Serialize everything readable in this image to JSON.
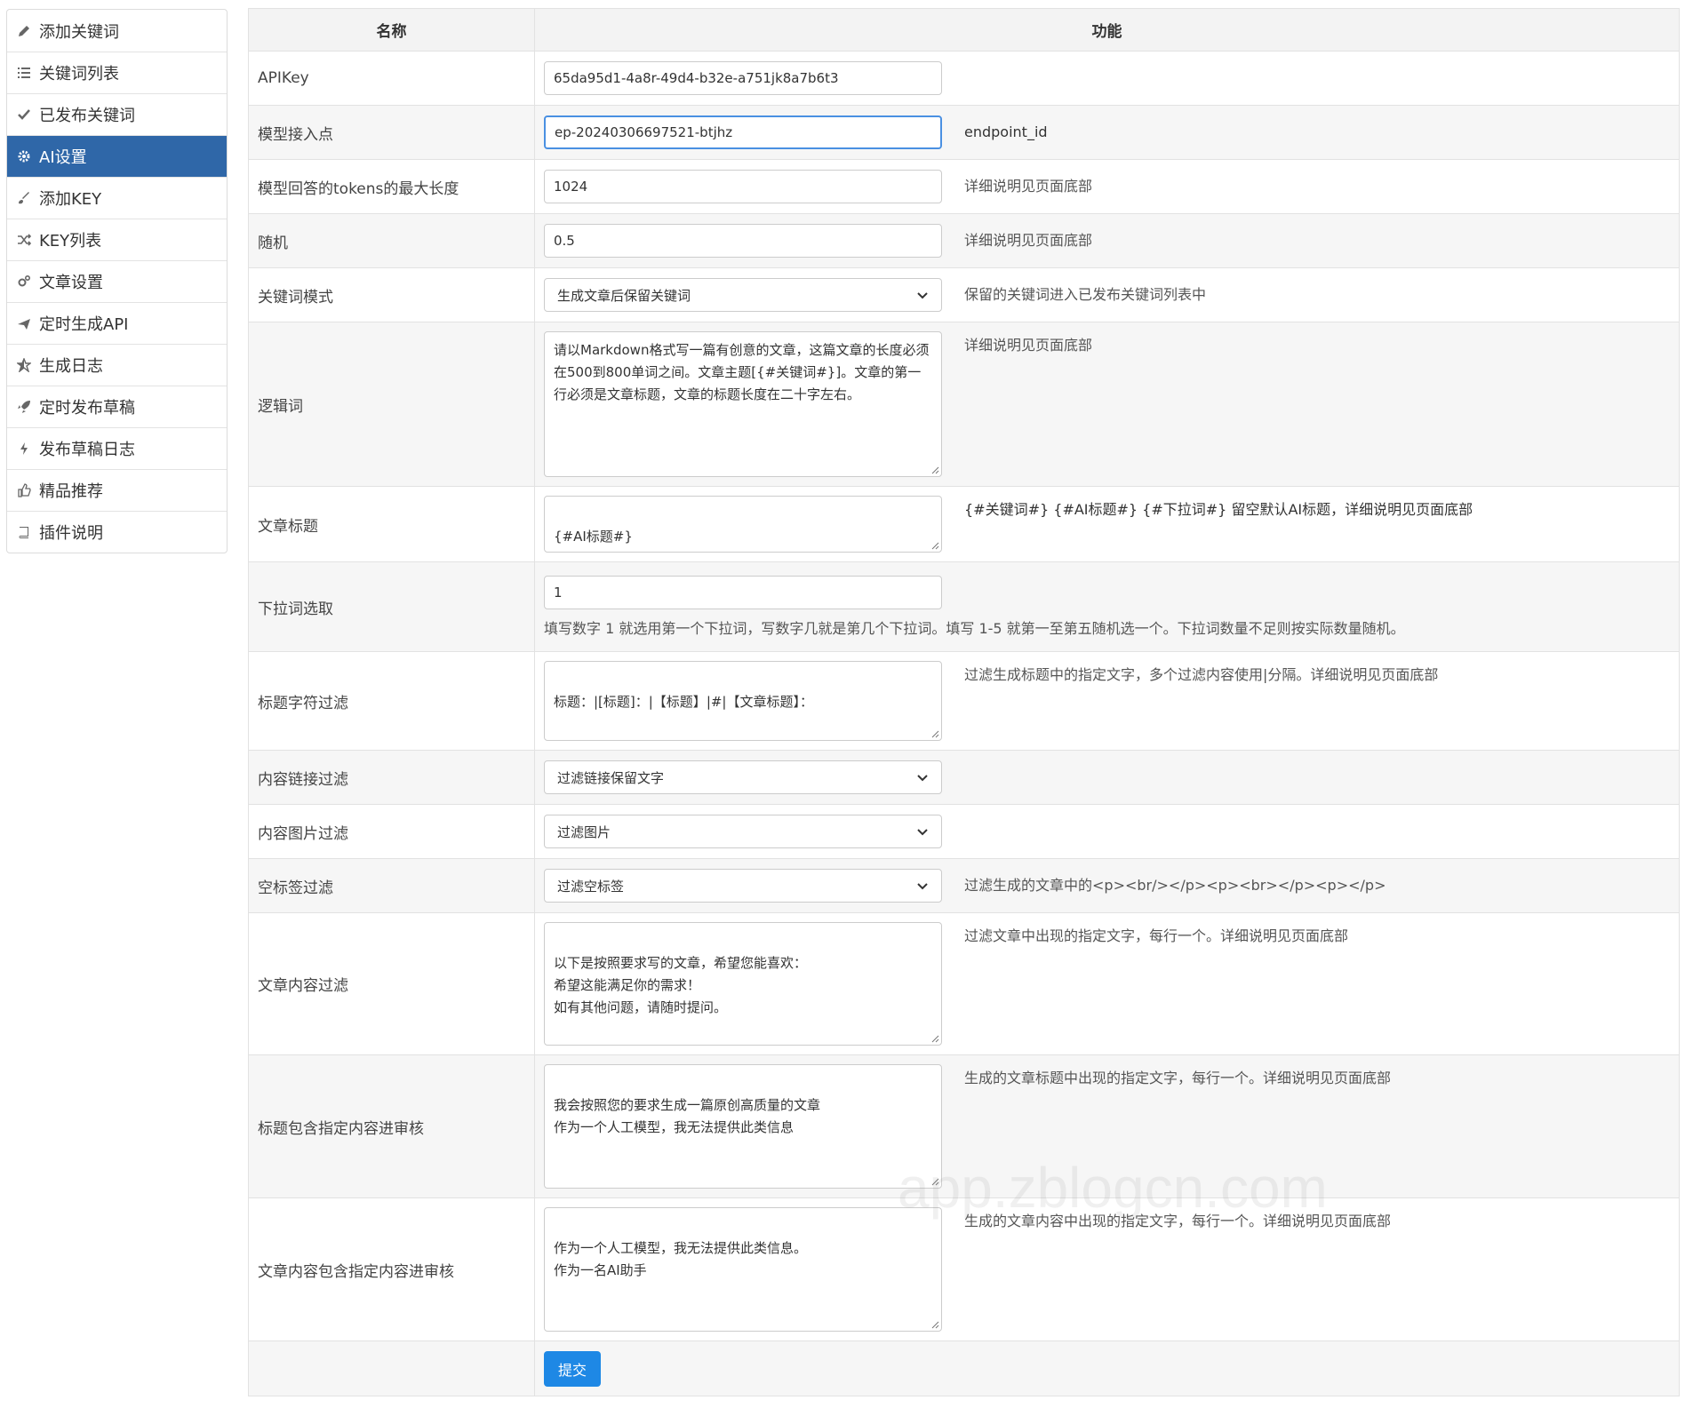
{
  "sidebar": {
    "items": [
      {
        "label": "添加关键词",
        "icon": "pencil-icon"
      },
      {
        "label": "关键词列表",
        "icon": "list-icon"
      },
      {
        "label": "已发布关键词",
        "icon": "check-icon"
      },
      {
        "label": "AI设置",
        "icon": "gear-icon",
        "active": true
      },
      {
        "label": "添加KEY",
        "icon": "brush-icon"
      },
      {
        "label": "KEY列表",
        "icon": "shuffle-icon"
      },
      {
        "label": "文章设置",
        "icon": "gears-icon"
      },
      {
        "label": "定时生成API",
        "icon": "plane-icon"
      },
      {
        "label": "生成日志",
        "icon": "star-half-icon"
      },
      {
        "label": "定时发布草稿",
        "icon": "rocket-icon"
      },
      {
        "label": "发布草稿日志",
        "icon": "bolt-icon"
      },
      {
        "label": "精品推荐",
        "icon": "thumbs-up-icon"
      },
      {
        "label": "插件说明",
        "icon": "book-icon"
      }
    ]
  },
  "table": {
    "header": {
      "name": "名称",
      "function": "功能"
    },
    "rows": {
      "apikey": {
        "label": "APIKey",
        "value": "65da95d1-4a8r-49d4-b32e-a751jk8a7b6t3"
      },
      "endpoint": {
        "label": "模型接入点",
        "value": "ep-20240306697521-btjhz",
        "help": "endpoint_id"
      },
      "tokens": {
        "label": "模型回答的tokens的最大长度",
        "value": "1024",
        "help": "详细说明见页面底部"
      },
      "random": {
        "label": "随机",
        "value": "0.5",
        "help": "详细说明见页面底部"
      },
      "keyword_mode": {
        "label": "关键词模式",
        "value": "生成文章后保留关键词",
        "help": "保留的关键词进入已发布关键词列表中"
      },
      "logic": {
        "label": "逻辑词",
        "value": "请以Markdown格式写一篇有创意的文章，这篇文章的长度必须在500到800单词之间。文章主题[{#关键词#}]。文章的第一行必须是文章标题，文章的标题长度在二十字左右。",
        "help": "详细说明见页面底部"
      },
      "title": {
        "label": "文章标题",
        "value": "{#AI标题#}",
        "help": "{#关键词#} {#AI标题#} {#下拉词#} 留空默认AI标题，详细说明见页面底部"
      },
      "dropdown": {
        "label": "下拉词选取",
        "value": "1",
        "help": "填写数字 1 就选用第一个下拉词，写数字几就是第几个下拉词。填写 1-5 就第一至第五随机选一个。下拉词数量不足则按实际数量随机。"
      },
      "title_filter": {
        "label": "标题字符过滤",
        "value": "标题：|[标题]：|【标题】|#|【文章标题】：",
        "help": "过滤生成标题中的指定文字，多个过滤内容使用|分隔。详细说明见页面底部"
      },
      "link_filter": {
        "label": "内容链接过滤",
        "value": "过滤链接保留文字"
      },
      "image_filter": {
        "label": "内容图片过滤",
        "value": "过滤图片"
      },
      "empty_tag_filter": {
        "label": "空标签过滤",
        "value": "过滤空标签",
        "help": "过滤生成的文章中的<p><br/></p><p><br></p><p></p>"
      },
      "content_filter": {
        "label": "文章内容过滤",
        "value": "以下是按照要求写的文章，希望您能喜欢：\n希望这能满足你的需求！\n如有其他问题，请随时提问。",
        "help": "过滤文章中出现的指定文字，每行一个。详细说明见页面底部"
      },
      "title_review": {
        "label": "标题包含指定内容进审核",
        "value": "我会按照您的要求生成一篇原创高质量的文章\n作为一个人工模型，我无法提供此类信息",
        "help": "生成的文章标题中出现的指定文字，每行一个。详细说明见页面底部"
      },
      "content_review": {
        "label": "文章内容包含指定内容进审核",
        "value": "作为一个人工模型，我无法提供此类信息。\n作为一名AI助手",
        "help": "生成的文章内容中出现的指定文字，每行一个。详细说明见页面底部"
      }
    },
    "submit_label": "提交"
  },
  "watermark": {
    "text": "app.zblogcn.com"
  }
}
